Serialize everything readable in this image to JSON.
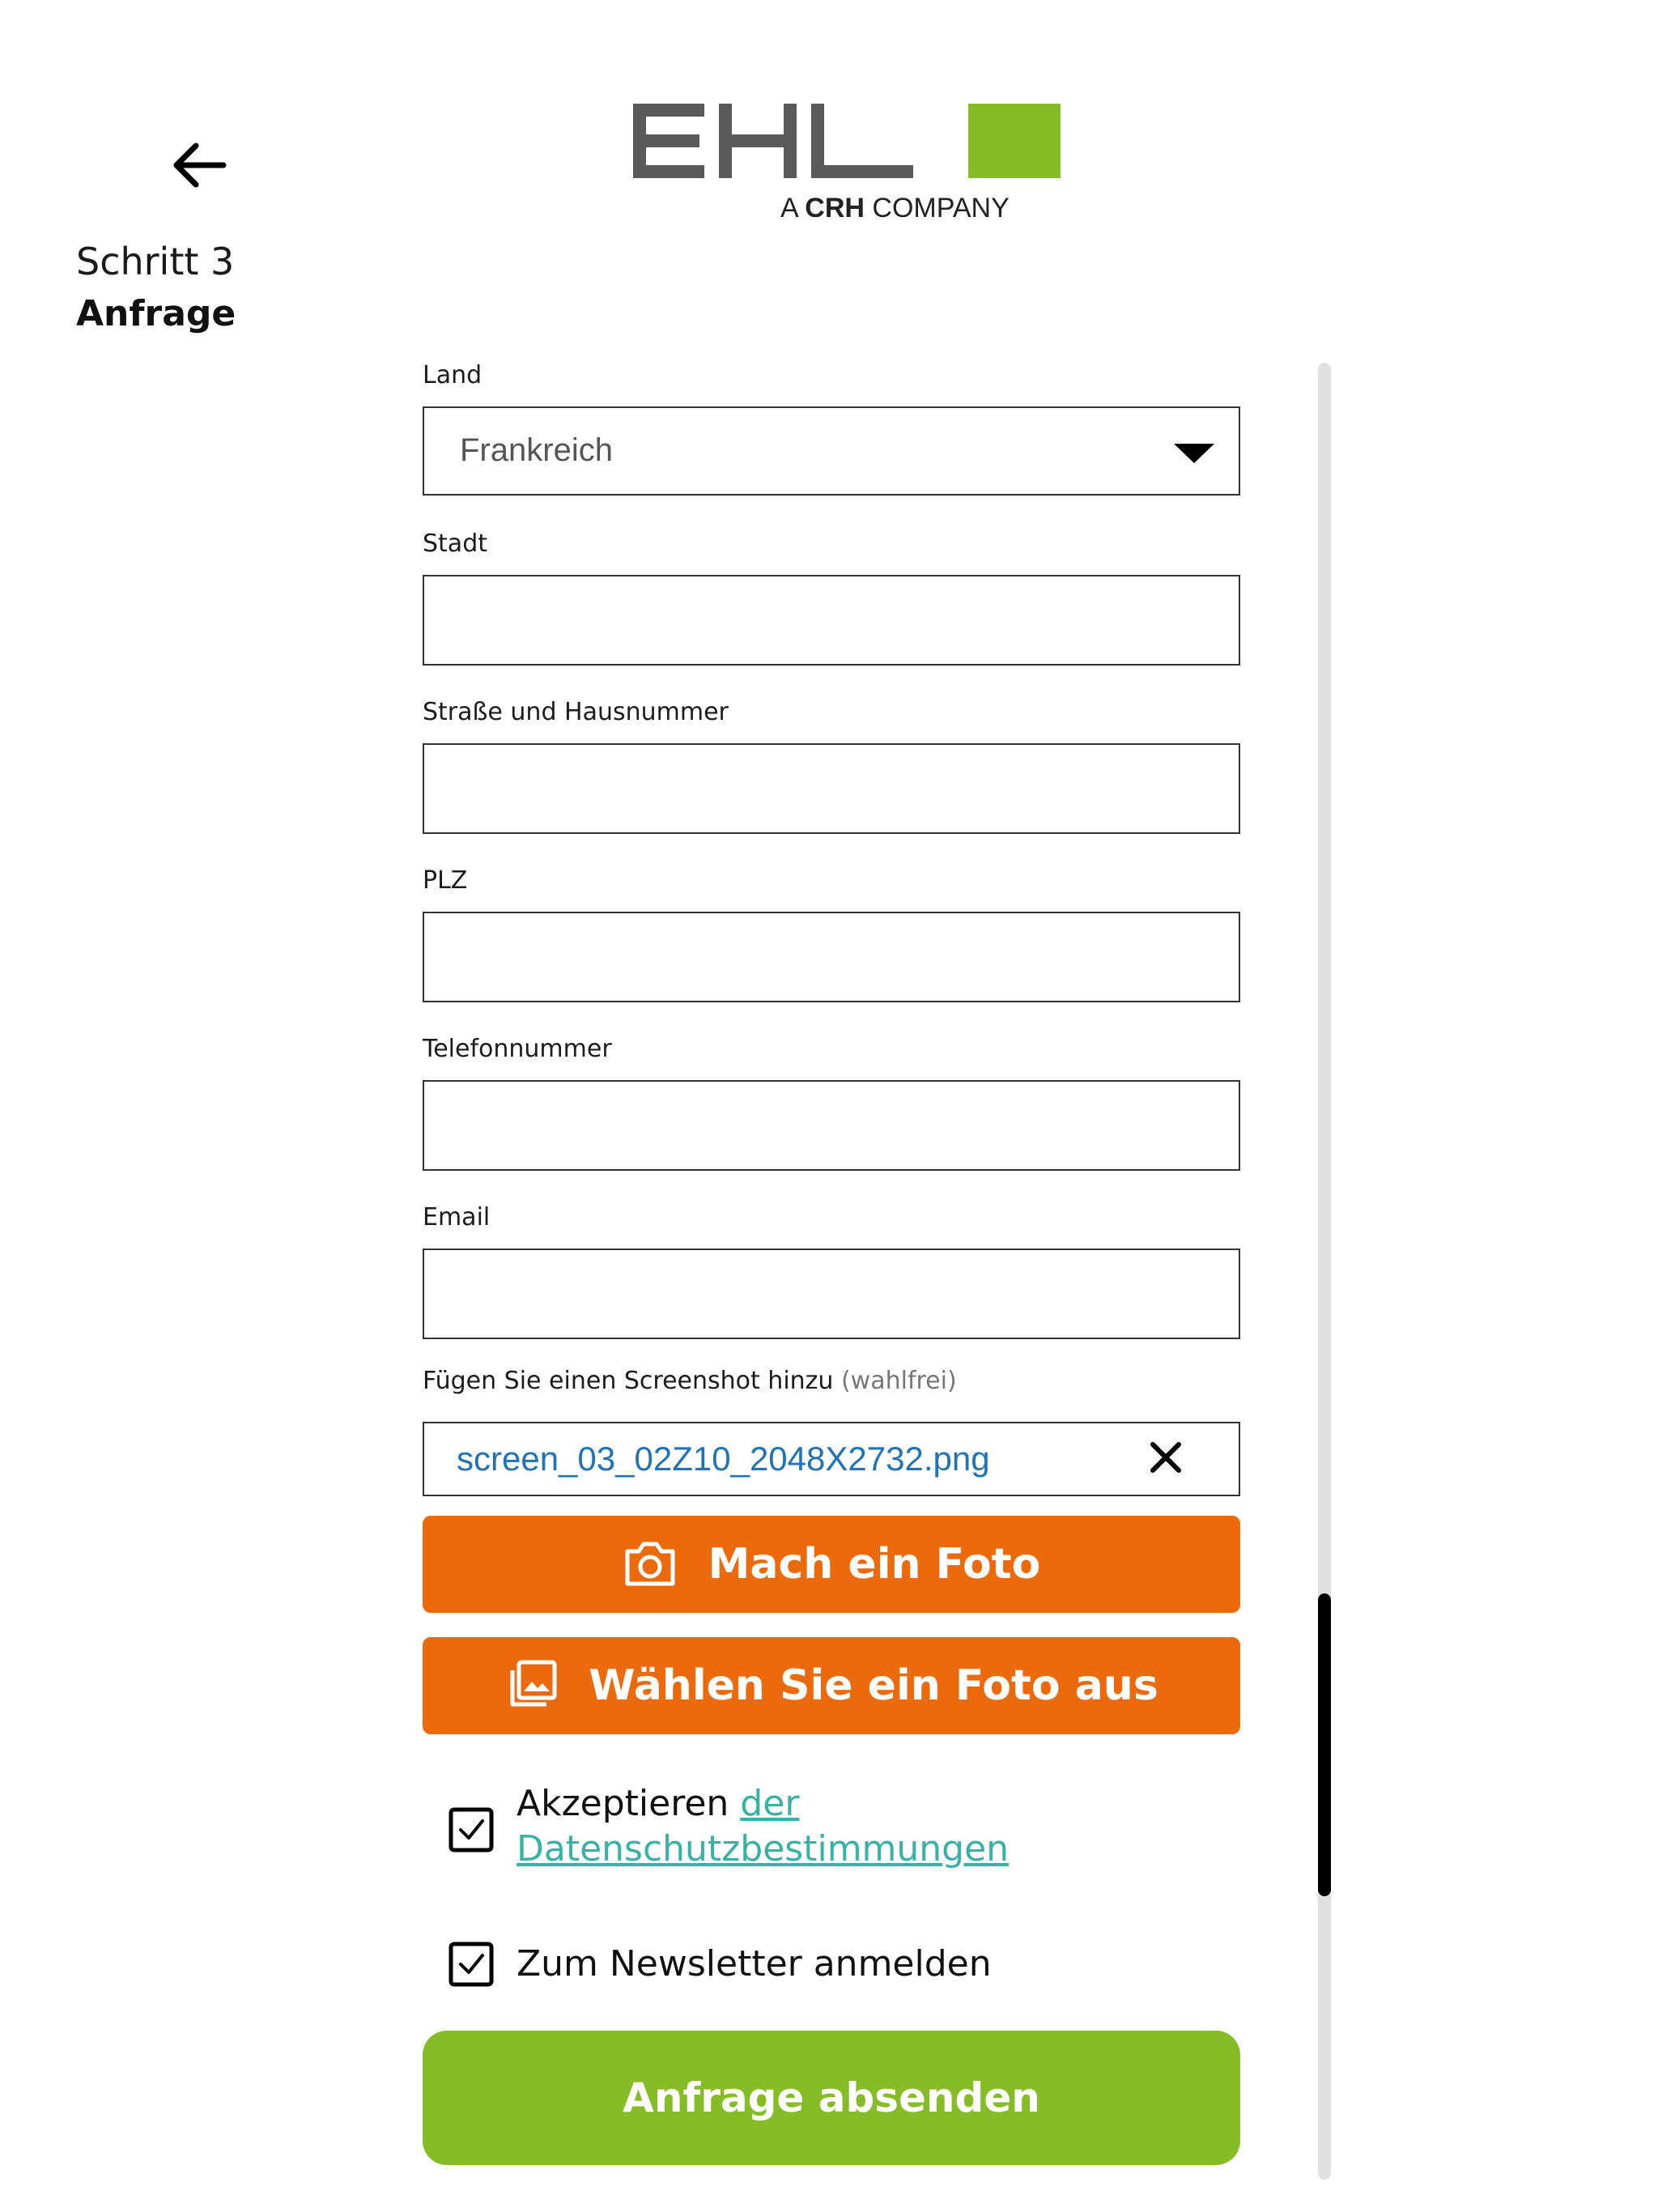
{
  "header": {
    "back_icon": "arrow-left-icon",
    "step_number": "Schritt 3",
    "step_name": "Anfrage"
  },
  "logo": {
    "brand": "EHL",
    "tagline_prefix": "A",
    "tagline_bold": "CRH",
    "tagline_suffix": "COMPANY",
    "colors": {
      "gray": "#5a5a5a",
      "green": "#86bc25"
    }
  },
  "form": {
    "land": {
      "label": "Land",
      "value": "Frankreich"
    },
    "stadt": {
      "label": "Stadt",
      "value": ""
    },
    "strasse": {
      "label": "Straße und Hausnummer",
      "value": ""
    },
    "plz": {
      "label": "PLZ",
      "value": ""
    },
    "telefon": {
      "label": "Telefonnummer",
      "value": ""
    },
    "email": {
      "label": "Email",
      "value": ""
    },
    "screenshot": {
      "label": "Fügen Sie einen Screenshot hinzu",
      "optional": "(wahlfrei)",
      "file_name": "screen_03_02Z10_2048X2732.png",
      "remove_icon": "close-icon"
    },
    "take_photo": {
      "label": "Mach ein Foto",
      "icon": "camera-icon"
    },
    "choose_photo": {
      "label": "Wählen Sie ein Foto aus",
      "icon": "gallery-icon"
    },
    "privacy": {
      "checked": true,
      "text": "Akzeptieren",
      "link_word": "der",
      "link_text": "Datenschutzbestimmungen"
    },
    "newsletter": {
      "checked": true,
      "text": "Zum Newsletter anmelden"
    },
    "submit": {
      "label": "Anfrage absenden"
    }
  },
  "colors": {
    "orange": "#ec6a0b",
    "green": "#86bc25",
    "link": "#36b3a6",
    "file_link": "#1f73b6"
  }
}
